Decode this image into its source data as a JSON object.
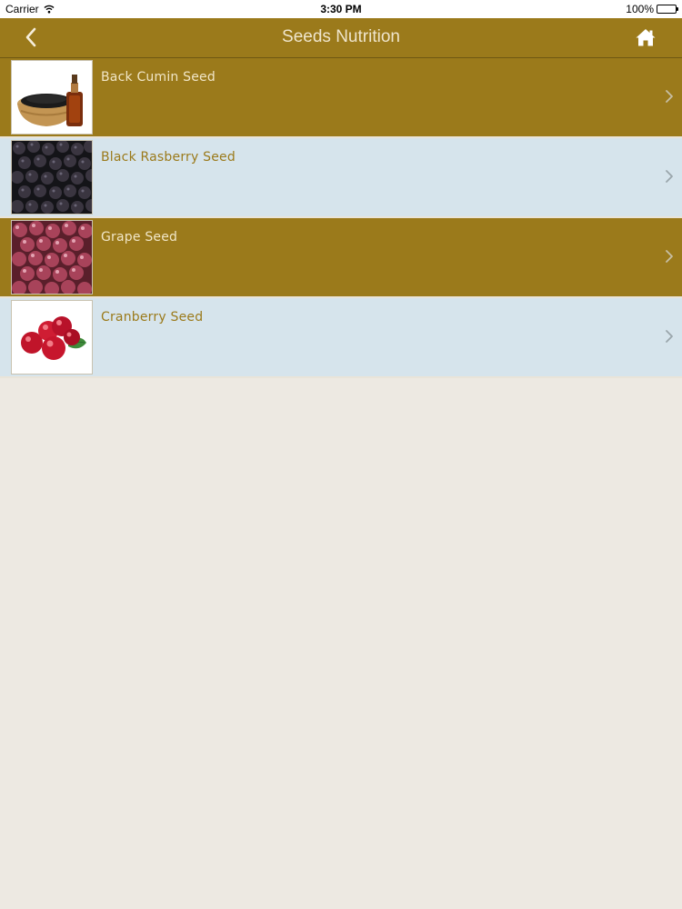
{
  "status_bar": {
    "carrier": "Carrier",
    "time": "3:30 PM",
    "battery": "100%",
    "battery_level": 1.0
  },
  "nav": {
    "title": "Seeds Nutrition",
    "back_icon": "chevron-left-icon",
    "home_icon": "home-icon"
  },
  "colors": {
    "nav_background": "#9b7a1b",
    "row_gold": "#9b7a1b",
    "row_blue": "#d6e4ec",
    "page_background": "#ede9e2"
  },
  "items": [
    {
      "label": "Back Cumin Seed",
      "image": "black-cumin-bowl-and-oil-bottle"
    },
    {
      "label": "Black Rasberry Seed",
      "image": "blackberries"
    },
    {
      "label": "Grape Seed",
      "image": "red-grapes"
    },
    {
      "label": "Cranberry Seed",
      "image": "cranberries-with-leaf"
    }
  ]
}
